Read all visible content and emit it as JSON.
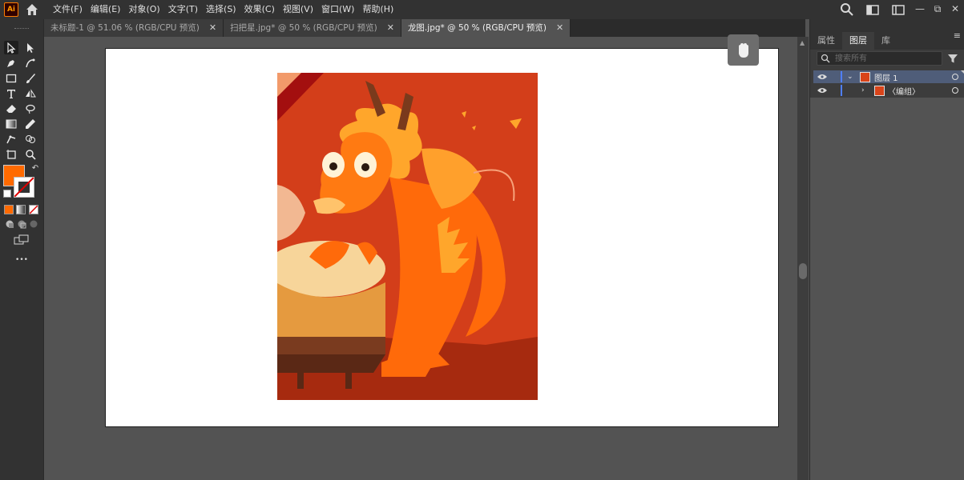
{
  "app": {
    "logo_text": "Ai"
  },
  "menu": {
    "items": [
      "文件(F)",
      "编辑(E)",
      "对象(O)",
      "文字(T)",
      "选择(S)",
      "效果(C)",
      "视图(V)",
      "窗口(W)",
      "帮助(H)"
    ]
  },
  "window_controls": {
    "minimize": "—",
    "restore": "⧉",
    "close": "✕"
  },
  "tabs": [
    {
      "label": "未标题-1 @ 51.06 % (RGB/CPU 预览)",
      "close": "✕",
      "active": false
    },
    {
      "label": "扫把星.jpg* @ 50 % (RGB/CPU 预览)",
      "close": "✕",
      "active": false
    },
    {
      "label": "龙图.jpg* @ 50 % (RGB/CPU 预览)",
      "close": "✕",
      "active": true
    }
  ],
  "toolbar": {
    "fill_color": "#ff6a00",
    "stroke_color": "none",
    "more_label": "•••"
  },
  "panel": {
    "tabs": [
      "属性",
      "图层",
      "库"
    ],
    "active_tab": "图层",
    "search_placeholder": "搜索所有",
    "layers": [
      {
        "name": "图层 1",
        "expanded": true,
        "selected": true
      },
      {
        "name": "〈编组〉",
        "expanded": false,
        "selected": false
      }
    ]
  },
  "colors": {
    "accent": "#ff6a00",
    "selection": "#4f5d79",
    "layer_color": "#4f7fff"
  }
}
